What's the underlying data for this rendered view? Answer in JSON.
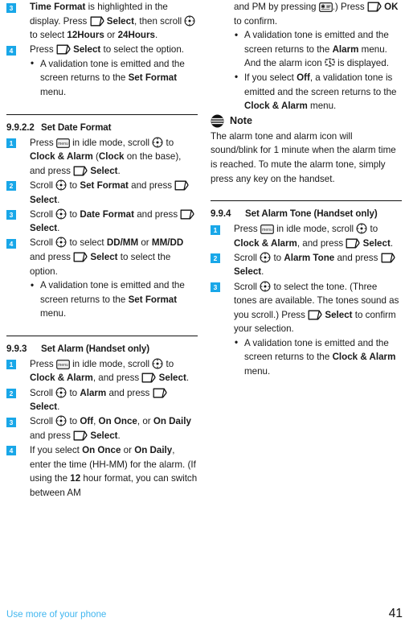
{
  "page": {
    "footer_breadcrumb": "Use more of your phone",
    "page_number": "41",
    "accent_color": "#19a7e8",
    "footer_link_color": "#41b6ef"
  },
  "icons": {
    "softkey": "softkey-select-icon",
    "scroll": "scroll-navigation-icon",
    "menu_key": "menu-key-icon",
    "star_key": "star-key-icon",
    "alarm": "alarm-icon",
    "note": "note-icon"
  },
  "left_column": [
    {
      "type": "steps",
      "name": "time-format-steps-continued",
      "items": [
        {
          "number": "3",
          "runs": [
            {
              "t": "Time Format",
              "b": true
            },
            {
              "t": " is highlighted in the display. Press "
            },
            {
              "icon": "softkey"
            },
            {
              "t": " "
            },
            {
              "t": "Select",
              "b": true
            },
            {
              "t": ", then scroll "
            },
            {
              "icon": "scroll"
            },
            {
              "t": " to select "
            },
            {
              "t": "12Hours",
              "b": true
            },
            {
              "t": " or "
            },
            {
              "t": "24Hours",
              "b": true
            },
            {
              "t": "."
            }
          ],
          "bullets": []
        },
        {
          "number": "4",
          "runs": [
            {
              "t": "Press "
            },
            {
              "icon": "softkey"
            },
            {
              "t": " "
            },
            {
              "t": "Select",
              "b": true
            },
            {
              "t": " to select the option."
            }
          ],
          "bullets": [
            {
              "runs": [
                {
                  "t": "A validation tone is emitted and the screen returns to the "
                },
                {
                  "t": "Set Format",
                  "b": true
                },
                {
                  "t": " menu."
                }
              ]
            }
          ]
        }
      ]
    },
    {
      "type": "rule",
      "name": "section-divider-date-format"
    },
    {
      "type": "section",
      "name": "section-set-date-format",
      "number": "9.9.2.2",
      "title": "Set Date Format",
      "items": [
        {
          "number": "1",
          "runs": [
            {
              "t": "Press "
            },
            {
              "icon": "menu_key"
            },
            {
              "t": " in idle mode, scroll "
            },
            {
              "icon": "scroll"
            },
            {
              "t": " to "
            },
            {
              "t": "Clock & Alarm",
              "b": true
            },
            {
              "t": " ("
            },
            {
              "t": "Clock",
              "b": true
            },
            {
              "t": " on the base), and press "
            },
            {
              "icon": "softkey"
            },
            {
              "t": " "
            },
            {
              "t": "Select",
              "b": true
            },
            {
              "t": "."
            }
          ],
          "bullets": []
        },
        {
          "number": "2",
          "runs": [
            {
              "t": "Scroll "
            },
            {
              "icon": "scroll"
            },
            {
              "t": " to "
            },
            {
              "t": "Set Format",
              "b": true
            },
            {
              "t": " and press "
            },
            {
              "icon": "softkey"
            },
            {
              "t": " "
            },
            {
              "t": "Select",
              "b": true
            },
            {
              "t": "."
            }
          ],
          "bullets": []
        },
        {
          "number": "3",
          "runs": [
            {
              "t": "Scroll "
            },
            {
              "icon": "scroll"
            },
            {
              "t": " to "
            },
            {
              "t": "Date Format",
              "b": true
            },
            {
              "t": " and press "
            },
            {
              "icon": "softkey"
            },
            {
              "t": " "
            },
            {
              "t": "Select",
              "b": true
            },
            {
              "t": "."
            }
          ],
          "bullets": []
        },
        {
          "number": "4",
          "runs": [
            {
              "t": "Scroll "
            },
            {
              "icon": "scroll"
            },
            {
              "t": " to select "
            },
            {
              "t": "DD/MM",
              "b": true
            },
            {
              "t": " or "
            },
            {
              "t": "MM/DD",
              "b": true
            },
            {
              "t": " and press "
            },
            {
              "icon": "softkey"
            },
            {
              "t": " "
            },
            {
              "t": "Select",
              "b": true
            },
            {
              "t": " to select the option."
            }
          ],
          "bullets": [
            {
              "runs": [
                {
                  "t": "A validation tone is emitted and the screen returns to the "
                },
                {
                  "t": "Set Format",
                  "b": true
                },
                {
                  "t": " menu."
                }
              ]
            }
          ]
        }
      ]
    },
    {
      "type": "rule",
      "name": "section-divider-set-alarm"
    },
    {
      "type": "section",
      "name": "section-set-alarm",
      "number": "9.9.3",
      "title": "Set Alarm (Handset only)",
      "items": [
        {
          "number": "1",
          "runs": [
            {
              "t": "Press "
            },
            {
              "icon": "menu_key"
            },
            {
              "t": " in idle mode, scroll "
            },
            {
              "icon": "scroll"
            },
            {
              "t": " to "
            },
            {
              "t": "Clock & Alarm",
              "b": true
            },
            {
              "t": ", and press "
            },
            {
              "icon": "softkey"
            },
            {
              "t": " "
            },
            {
              "t": "Select",
              "b": true
            },
            {
              "t": "."
            }
          ],
          "bullets": []
        },
        {
          "number": "2",
          "runs": [
            {
              "t": "Scroll "
            },
            {
              "icon": "scroll"
            },
            {
              "t": " to "
            },
            {
              "t": "Alarm",
              "b": true
            },
            {
              "t": " and press "
            },
            {
              "icon": "softkey"
            },
            {
              "t": " "
            },
            {
              "t": "Select",
              "b": true
            },
            {
              "t": "."
            }
          ],
          "bullets": []
        },
        {
          "number": "3",
          "runs": [
            {
              "t": "Scroll "
            },
            {
              "icon": "scroll"
            },
            {
              "t": " to "
            },
            {
              "t": "Off",
              "b": true
            },
            {
              "t": ", "
            },
            {
              "t": "On Once",
              "b": true
            },
            {
              "t": ", or "
            },
            {
              "t": "On Daily",
              "b": true
            },
            {
              "t": " and press "
            },
            {
              "icon": "softkey"
            },
            {
              "t": " "
            },
            {
              "t": "Select",
              "b": true
            },
            {
              "t": "."
            }
          ],
          "bullets": []
        },
        {
          "number": "4",
          "runs": [
            {
              "t": "If you select "
            },
            {
              "t": "On Once",
              "b": true
            },
            {
              "t": " or "
            },
            {
              "t": "On Daily",
              "b": true
            },
            {
              "t": ", enter the time (HH-MM) for the alarm. (If using the "
            },
            {
              "t": "12",
              "b": true
            },
            {
              "t": " hour format, you can switch between AM"
            }
          ],
          "bullets": []
        }
      ]
    }
  ],
  "right_column": [
    {
      "type": "steps",
      "name": "set-alarm-steps-continued",
      "items": [
        {
          "number": "",
          "runs": [
            {
              "t": "and PM by pressing "
            },
            {
              "icon": "star_key"
            },
            {
              "t": ".) Press "
            },
            {
              "icon": "softkey"
            },
            {
              "t": " "
            },
            {
              "t": "OK",
              "b": true
            },
            {
              "t": " to confirm."
            }
          ],
          "bullets": [
            {
              "runs": [
                {
                  "t": "A validation tone is emitted and the screen returns to the "
                },
                {
                  "t": "Alarm",
                  "b": true
                },
                {
                  "t": " menu. And the alarm icon "
                },
                {
                  "icon": "alarm"
                },
                {
                  "t": " is displayed."
                }
              ]
            },
            {
              "runs": [
                {
                  "t": "If you select "
                },
                {
                  "t": "Off",
                  "b": true
                },
                {
                  "t": ", a validation tone is emitted and the screen returns to the "
                },
                {
                  "t": "Clock & Alarm",
                  "b": true
                },
                {
                  "t": " menu."
                }
              ]
            }
          ]
        }
      ]
    },
    {
      "type": "note",
      "name": "note-alarm-tone",
      "title": "Note",
      "body": "The alarm tone and alarm icon will sound/blink for 1 minute when the alarm time is reached. To mute the alarm tone, simply press any key on the handset."
    },
    {
      "type": "rule",
      "name": "section-divider-alarm-tone"
    },
    {
      "type": "section",
      "name": "section-set-alarm-tone",
      "number": "9.9.4",
      "title": "Set Alarm Tone (Handset only)",
      "items": [
        {
          "number": "1",
          "runs": [
            {
              "t": "Press "
            },
            {
              "icon": "menu_key"
            },
            {
              "t": " in idle mode, scroll "
            },
            {
              "icon": "scroll"
            },
            {
              "t": " to "
            },
            {
              "t": "Clock & Alarm",
              "b": true
            },
            {
              "t": ", and press "
            },
            {
              "icon": "softkey"
            },
            {
              "t": " "
            },
            {
              "t": "Select",
              "b": true
            },
            {
              "t": "."
            }
          ],
          "bullets": []
        },
        {
          "number": "2",
          "runs": [
            {
              "t": "Scroll "
            },
            {
              "icon": "scroll"
            },
            {
              "t": " to "
            },
            {
              "t": "Alarm Tone",
              "b": true
            },
            {
              "t": " and press "
            },
            {
              "icon": "softkey"
            },
            {
              "t": " "
            },
            {
              "t": "Select",
              "b": true
            },
            {
              "t": "."
            }
          ],
          "bullets": []
        },
        {
          "number": "3",
          "runs": [
            {
              "t": "Scroll "
            },
            {
              "icon": "scroll"
            },
            {
              "t": " to select the tone. (Three tones are available. The tones sound as you scroll.) Press "
            },
            {
              "icon": "softkey"
            },
            {
              "t": " "
            },
            {
              "t": "Select",
              "b": true
            },
            {
              "t": " to confirm your selection."
            }
          ],
          "bullets": [
            {
              "runs": [
                {
                  "t": "A validation tone is emitted and the screen returns to the "
                },
                {
                  "t": "Clock & Alarm",
                  "b": true
                },
                {
                  "t": " menu."
                }
              ]
            }
          ]
        }
      ]
    }
  ]
}
